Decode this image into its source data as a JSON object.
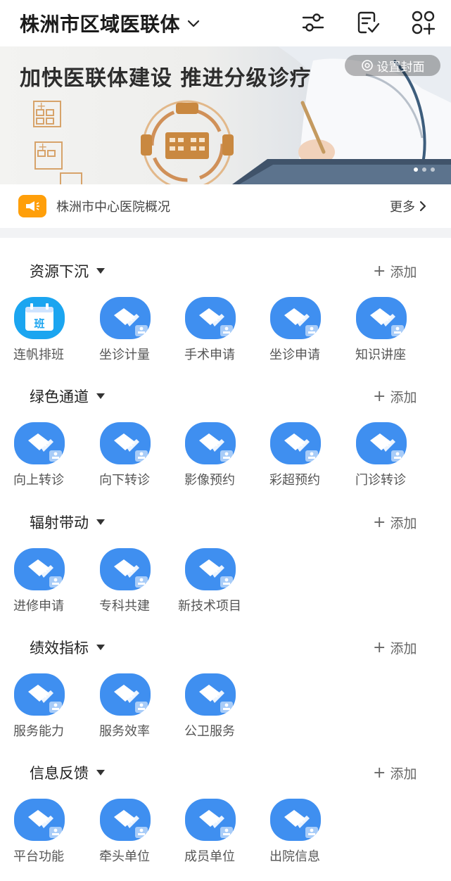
{
  "header": {
    "title": "株洲市区域医联体"
  },
  "banner": {
    "headline": "加快医联体建设 推进分级诊疗",
    "cover_button": "设置封面",
    "dots": 3,
    "active_dot": 0
  },
  "notice": {
    "text": "株洲市中心医院概况",
    "more": "更多"
  },
  "colors": {
    "accent_blue": "#3f8ff0",
    "notice_orange": "#ff9f0a"
  },
  "sections": [
    {
      "title": "资源下沉",
      "add": "添加",
      "items": [
        {
          "label": "连帆排班",
          "icon": "calendar-ban-icon"
        },
        {
          "label": "坐诊计量",
          "icon": "handshake-icon"
        },
        {
          "label": "手术申请",
          "icon": "handshake-icon"
        },
        {
          "label": "坐诊申请",
          "icon": "handshake-icon"
        },
        {
          "label": "知识讲座",
          "icon": "handshake-icon"
        }
      ]
    },
    {
      "title": "绿色通道",
      "add": "添加",
      "items": [
        {
          "label": "向上转诊",
          "icon": "handshake-icon"
        },
        {
          "label": "向下转诊",
          "icon": "handshake-icon"
        },
        {
          "label": "影像预约",
          "icon": "handshake-icon"
        },
        {
          "label": "彩超预约",
          "icon": "handshake-icon"
        },
        {
          "label": "门诊转诊",
          "icon": "handshake-icon"
        }
      ]
    },
    {
      "title": "辐射带动",
      "add": "添加",
      "items": [
        {
          "label": "进修申请",
          "icon": "handshake-icon"
        },
        {
          "label": "专科共建",
          "icon": "handshake-icon"
        },
        {
          "label": "新技术项目",
          "icon": "handshake-icon"
        }
      ]
    },
    {
      "title": "绩效指标",
      "add": "添加",
      "items": [
        {
          "label": "服务能力",
          "icon": "handshake-icon"
        },
        {
          "label": "服务效率",
          "icon": "handshake-icon"
        },
        {
          "label": "公卫服务",
          "icon": "handshake-icon"
        }
      ]
    },
    {
      "title": "信息反馈",
      "add": "添加",
      "items": [
        {
          "label": "平台功能",
          "icon": "handshake-icon"
        },
        {
          "label": "牵头单位",
          "icon": "handshake-icon"
        },
        {
          "label": "成员单位",
          "icon": "handshake-icon"
        },
        {
          "label": "出院信息",
          "icon": "handshake-icon"
        }
      ]
    }
  ]
}
